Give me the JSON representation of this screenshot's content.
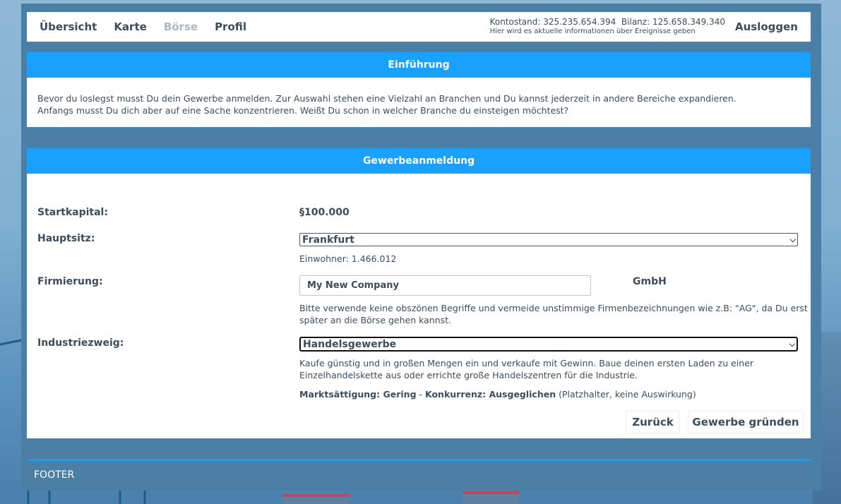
{
  "nav": {
    "items": [
      {
        "label": "Übersicht",
        "state": "active"
      },
      {
        "label": "Karte",
        "state": "active"
      },
      {
        "label": "Börse",
        "state": "disabled"
      },
      {
        "label": "Profil",
        "state": "active"
      }
    ],
    "balance_line": "Kontostand: 325.235.654.394  Bilanz: 125.658.349.340",
    "info_line": "Hier wird es aktuelle informationen über Ereignisse geben",
    "logout_label": "Ausloggen"
  },
  "intro": {
    "title": "Einführung",
    "line1": "Bevor du loslegst musst Du dein Gewerbe anmelden. Zur Auswahl stehen eine Vielzahl an Branchen und Du kannst jederzeit in andere Bereiche expandieren.",
    "line2": "Anfangs musst Du dich aber auf eine Sache konzentrieren. Weißt Du schon in welcher Branche du einsteigen möchtest?"
  },
  "form": {
    "title": "Gewerbeanmeldung",
    "capital_label": "Startkapital:",
    "capital_value": "§100.000",
    "hq_label": "Hauptsitz:",
    "hq_value": "Frankfurt",
    "hq_info": "Einwohner: 1.466.012",
    "company_label": "Firmierung:",
    "company_value": "My New Company",
    "company_suffix": "GmbH",
    "company_hint_1": "Bitte verwende keine obszönen Begriffe und vermeide unstimmige Firmenbezeichnungen wie z.B: \"AG\", da Du erst",
    "company_hint_2": "später an die Börse gehen kannst.",
    "industry_label": "Industriezweig:",
    "industry_value": "Handelsgewerbe",
    "industry_desc_1": "Kaufe günstig und in großen Mengen ein und verkaufe mit Gewinn. Baue deinen ersten Laden zu einer",
    "industry_desc_2": "Einzelhandelskette aus oder errichte große Handelszentren für die Industrie.",
    "saturation_label": "Marktsättigung: Gering",
    "separator": " - ",
    "competition_label": "Konkurrenz: Ausgeglichen",
    "placeholder_note": " (Platzhalter, keine Auswirkung)",
    "back_label": "Zurück",
    "submit_label": "Gewerbe gründen"
  },
  "footer": {
    "label": "FOOTER"
  },
  "colors": {
    "accent": "#1aa1ff",
    "frame": "#4b7fa6",
    "text": "#3b4d5e",
    "muted": "#a8b8c4"
  }
}
